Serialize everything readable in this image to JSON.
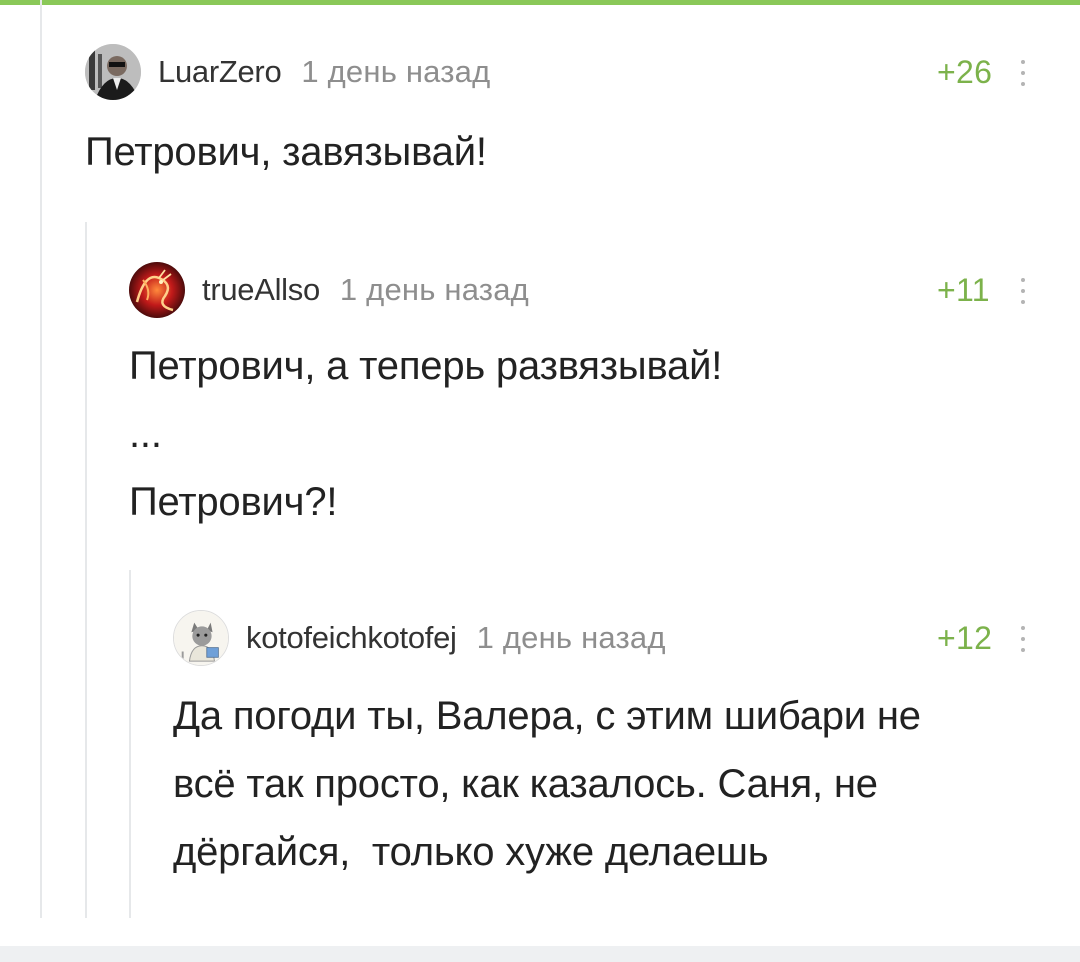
{
  "comments": [
    {
      "username": "LuarZero",
      "time": "1 день назад",
      "rating": "+26",
      "avatar_icon": "user-photo-avatar",
      "body": [
        "Петрович, завязывай!"
      ]
    },
    {
      "username": "trueAllso",
      "time": "1 день назад",
      "rating": "+11",
      "avatar_icon": "dragon-avatar",
      "body": [
        "Петрович, а теперь развязывай!",
        "...",
        "Петрович?!"
      ]
    },
    {
      "username": "kotofeichkotofej",
      "time": "1 день назад",
      "rating": "+12",
      "avatar_icon": "cat-avatar",
      "body": [
        "Да погоди ты, Валера, с этим шибари не",
        "всё так просто, как казалось. Саня, не",
        "дёргайся,  только хуже делаешь"
      ]
    }
  ],
  "colors": {
    "accent": "#8ac858",
    "rating": "#7cb24b",
    "muted": "#8e8e8e",
    "thread_line": "#e6e8ea"
  }
}
